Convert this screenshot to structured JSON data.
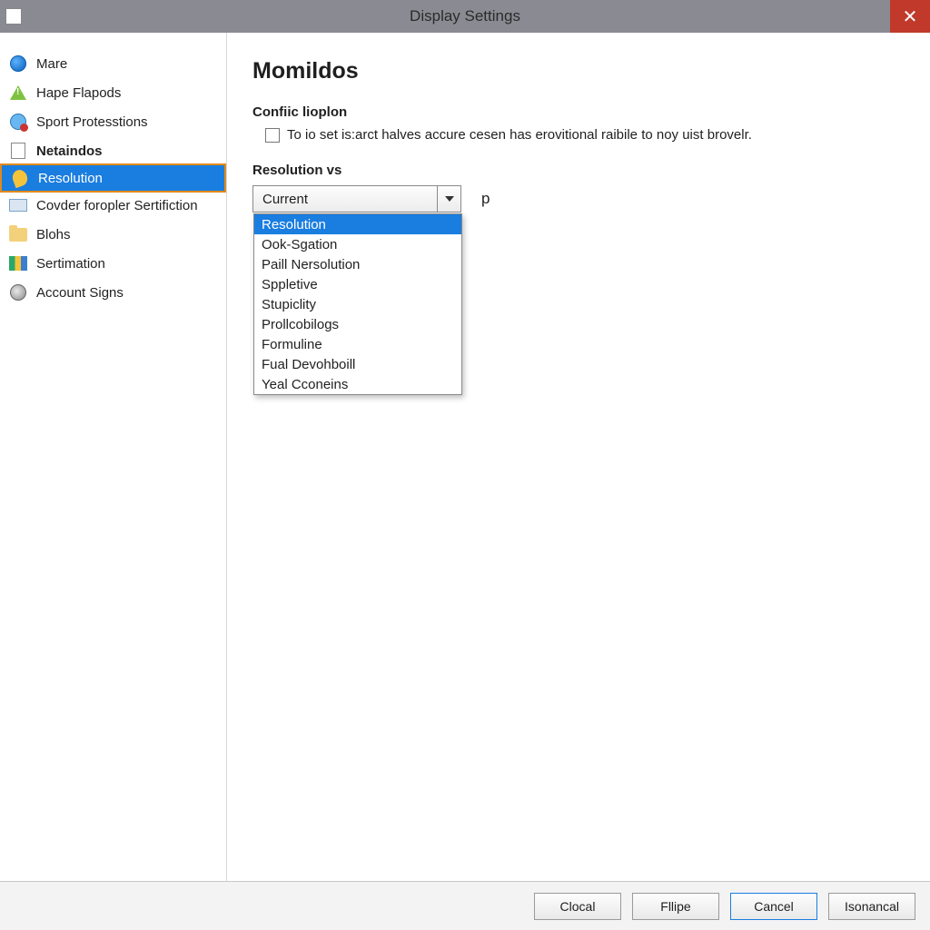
{
  "window": {
    "title": "Display Settings"
  },
  "sidebar": {
    "items": [
      {
        "label": "Mare",
        "icon": "globe-icon"
      },
      {
        "label": "Hape Flapods",
        "icon": "warn-icon"
      },
      {
        "label": "Sport Protesstions",
        "icon": "sport-icon"
      },
      {
        "label": "Netaindos",
        "icon": "doc-icon",
        "bold": true
      },
      {
        "label": "Resolution",
        "icon": "pin-icon",
        "selected": true
      },
      {
        "label": "Covder foropler Sertifiction",
        "icon": "card-icon"
      },
      {
        "label": "Blohs",
        "icon": "folder-icon"
      },
      {
        "label": "Sertimation",
        "icon": "cert-icon"
      },
      {
        "label": "Account Signs",
        "icon": "account-icon"
      }
    ]
  },
  "main": {
    "heading": "Momildos",
    "section1_label": "Confiic lioplon",
    "checkbox_label": "To io set is:arct halves accure cesen has erovitional raibile to noy uist brovelr.",
    "section2_label": "Resolution vs",
    "combo_selected": "Current",
    "combo_after": "p",
    "dropdown_options": [
      "Resolution",
      "Ook-Sgation",
      "Paill Nersolution",
      "Sppletive",
      "Stupiclity",
      "Prollcobilogs",
      "Formuline",
      "Fual Devohboill",
      "Yeal Cconeins"
    ],
    "dropdown_highlight_index": 0
  },
  "footer": {
    "buttons": [
      {
        "label": "Clocal",
        "primary": false
      },
      {
        "label": "Fllipe",
        "primary": false
      },
      {
        "label": "Cancel",
        "primary": true
      },
      {
        "label": "Isonancal",
        "primary": false
      }
    ]
  }
}
